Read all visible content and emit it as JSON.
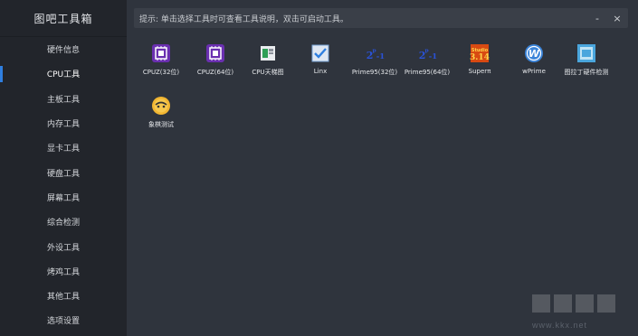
{
  "app": {
    "title": "图吧工具箱"
  },
  "sidebar": {
    "items": [
      {
        "label": "硬件信息",
        "active": false
      },
      {
        "label": "CPU工具",
        "active": true
      },
      {
        "label": "主板工具",
        "active": false
      },
      {
        "label": "内存工具",
        "active": false
      },
      {
        "label": "显卡工具",
        "active": false
      },
      {
        "label": "硬盘工具",
        "active": false
      },
      {
        "label": "屏幕工具",
        "active": false
      },
      {
        "label": "综合检测",
        "active": false
      },
      {
        "label": "外设工具",
        "active": false
      },
      {
        "label": "烤鸡工具",
        "active": false
      },
      {
        "label": "其他工具",
        "active": false
      },
      {
        "label": "选项设置",
        "active": false
      }
    ]
  },
  "header": {
    "hint": "提示: 单击选择工具时可查看工具说明，双击可启动工具。",
    "minimize_label": "-",
    "close_label": "×"
  },
  "tools": [
    {
      "label": "CPUZ(32位)",
      "icon": "cpu-chip-icon"
    },
    {
      "label": "CPUZ(64位)",
      "icon": "cpu-chip-icon"
    },
    {
      "label": "CPU天梯图",
      "icon": "ladder-chart-icon"
    },
    {
      "label": "Linx",
      "icon": "checkbox-icon"
    },
    {
      "label": "Prime95(32位)",
      "icon": "prime95-icon"
    },
    {
      "label": "Prime95(64位)",
      "icon": "prime95-icon"
    },
    {
      "label": "Superπ",
      "icon": "superpi-icon"
    },
    {
      "label": "wPrime",
      "icon": "wprime-icon"
    },
    {
      "label": "图拉丁硬件检测",
      "icon": "hardware-detect-icon"
    },
    {
      "label": "象棋测试",
      "icon": "chess-icon"
    }
  ],
  "watermark": {
    "text": "www.kkx.net"
  },
  "colors": {
    "sidebar_bg": "#22252b",
    "content_bg": "#2f343d",
    "accent": "#2f7fe0"
  }
}
